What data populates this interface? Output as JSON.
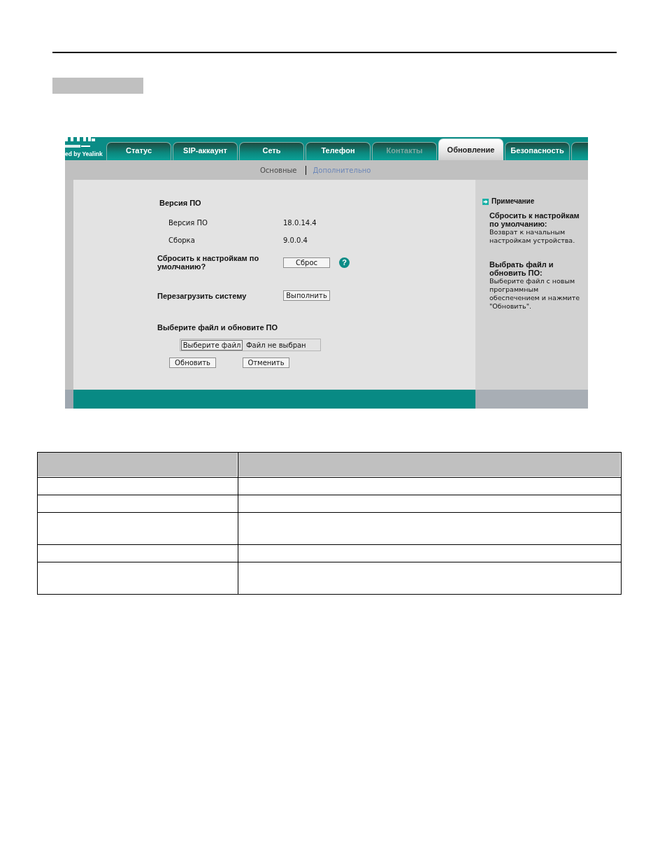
{
  "screen": {
    "logo": {
      "tagline": "ed by Yealink"
    },
    "tabs": [
      {
        "kind": "full",
        "label": "Статус",
        "selected": false,
        "disabled": false
      },
      {
        "kind": "full",
        "label": "SIP-аккаунт",
        "selected": false,
        "disabled": false
      },
      {
        "kind": "full",
        "label": "Сеть",
        "selected": false,
        "disabled": false
      },
      {
        "kind": "full",
        "label": "Телефон",
        "selected": false,
        "disabled": false
      },
      {
        "kind": "full",
        "label": "Контакты",
        "selected": false,
        "disabled": true
      },
      {
        "kind": "full",
        "label": "Обновление",
        "selected": true,
        "disabled": false
      },
      {
        "kind": "full",
        "label": "Безопасность",
        "selected": false,
        "disabled": false
      },
      {
        "kind": "partial",
        "selected": false
      }
    ],
    "subtabs": [
      {
        "label": "Основные",
        "selected": true
      },
      {
        "label": "Дополнительно",
        "selected": false
      }
    ],
    "firmware": {
      "heading": "Версия ПО",
      "rows": [
        {
          "label": "Версия ПО",
          "value": "18.0.14.4"
        },
        {
          "label": "Сборка",
          "value": "9.0.0.4"
        }
      ]
    },
    "actions": [
      {
        "label": "Сбросить к настройкам по умолчанию?",
        "button": "Сброс",
        "help_icon": "?"
      },
      {
        "label": "Перезагрузить систему",
        "button": "Выполнить"
      }
    ],
    "upgrade": {
      "heading": "Выберите файл и обновите ПО",
      "file_button": "Выберите файл",
      "file_status": "Файл не выбран",
      "buttons": [
        "Обновить",
        "Отменить"
      ]
    },
    "note": {
      "title": "Примечание",
      "items": [
        {
          "title": "Сбросить к настройкам по умолчанию:",
          "text": "Возврат к начальным настройкам устройства."
        },
        {
          "title": "Выбрать файл и обновить ПО:",
          "text": "Выберите файл с новым программным обеспечением и нажмите \"Обновить\"."
        }
      ]
    }
  },
  "table": {
    "rows": [
      {
        "kind": "header"
      },
      {
        "kind": "single"
      },
      {
        "kind": "single"
      },
      {
        "kind": "double"
      },
      {
        "kind": "single"
      },
      {
        "kind": "double"
      }
    ]
  }
}
